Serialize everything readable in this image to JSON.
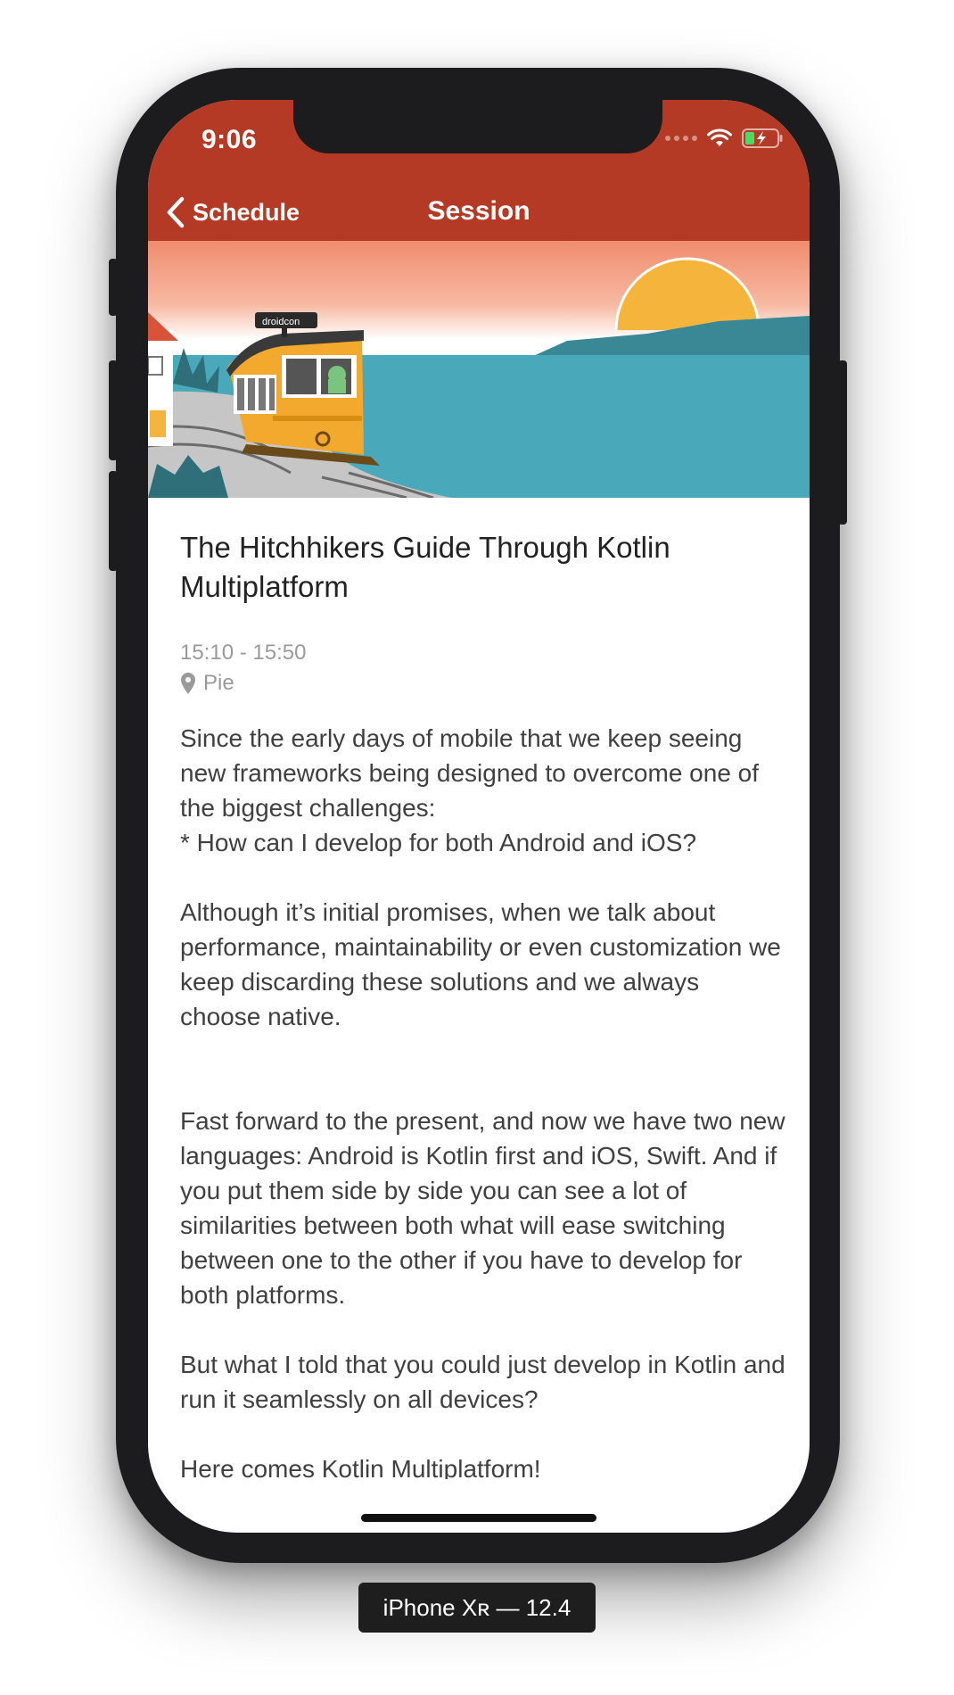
{
  "status_bar": {
    "time": "9:06"
  },
  "nav": {
    "back_label": "Schedule",
    "title": "Session"
  },
  "banner": {
    "tram_sign": "droidcon"
  },
  "session": {
    "title": "The Hitchhikers Guide Through Kotlin Multiplatform",
    "time_range": "15:10 - 15:50",
    "room": "Pie",
    "paragraphs": [
      "Since the early days of mobile that we keep seeing new frameworks being designed to overcome one of the biggest challenges:\n* How can I develop for both Android and iOS?",
      "Although it’s initial promises, when we talk about performance, maintainability or even customization we keep discarding these solutions and we always choose native.",
      "Fast forward to the present, and now we have two new languages: Android is Kotlin first and iOS, Swift. And if you put them side by side you can see a lot of similarities between both what will ease switching between one to the other if you have to develop for both platforms.",
      "But what I told that you could just develop in Kotlin and run it seamlessly on all devices?",
      "Here comes Kotlin Multiplatform!"
    ]
  },
  "device_label": "iPhone Xʀ — 12.4",
  "colors": {
    "accent": "#b43a25",
    "sky_top": "#f08c6e",
    "sea": "#4aa8bb",
    "sun": "#f5b53c",
    "tram": "#f2a92d"
  }
}
